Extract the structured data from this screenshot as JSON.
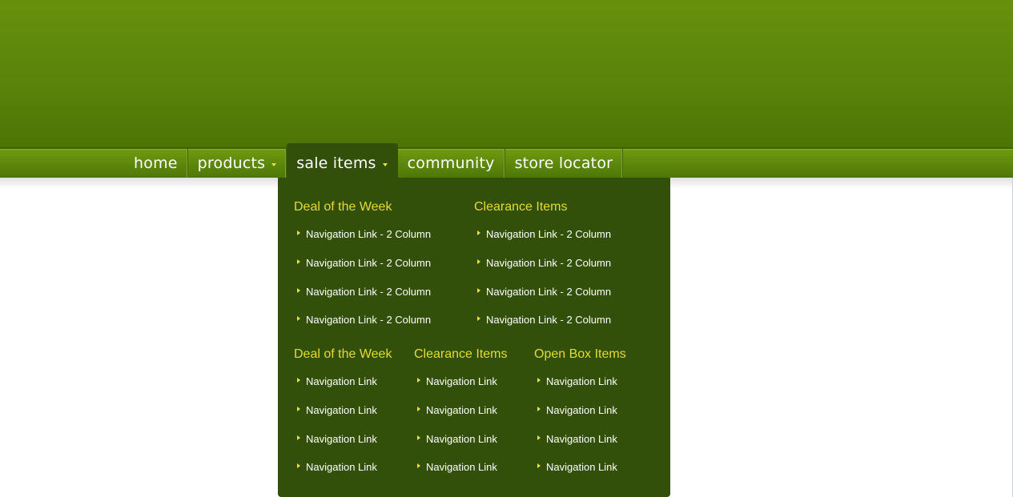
{
  "nav": {
    "items": [
      {
        "label": "home",
        "caret": false
      },
      {
        "label": "products",
        "caret": true
      },
      {
        "label": "sale items",
        "caret": true
      },
      {
        "label": "community",
        "caret": false
      },
      {
        "label": "store locator",
        "caret": false
      }
    ]
  },
  "dropdown": {
    "section1": {
      "columns": [
        {
          "title": "Deal of the Week",
          "links": [
            "Navigation Link - 2 Column",
            "Navigation Link - 2 Column",
            "Navigation Link - 2 Column",
            "Navigation Link - 2 Column"
          ]
        },
        {
          "title": "Clearance Items",
          "links": [
            "Navigation Link - 2 Column",
            "Navigation Link - 2 Column",
            "Navigation Link - 2 Column",
            "Navigation Link - 2 Column"
          ]
        }
      ]
    },
    "section2": {
      "columns": [
        {
          "title": "Deal of the Week",
          "links": [
            "Navigation Link",
            "Navigation Link",
            "Navigation Link",
            "Navigation Link"
          ]
        },
        {
          "title": "Clearance Items",
          "links": [
            "Navigation Link",
            "Navigation Link",
            "Navigation Link",
            "Navigation Link"
          ]
        },
        {
          "title": "Open Box Items",
          "links": [
            "Navigation Link",
            "Navigation Link",
            "Navigation Link",
            "Navigation Link"
          ]
        }
      ]
    }
  },
  "colors": {
    "header": "#5a840a",
    "dropdown_bg": "#33500a",
    "heading": "#e4dc34",
    "bullet": "#e8e23a"
  }
}
